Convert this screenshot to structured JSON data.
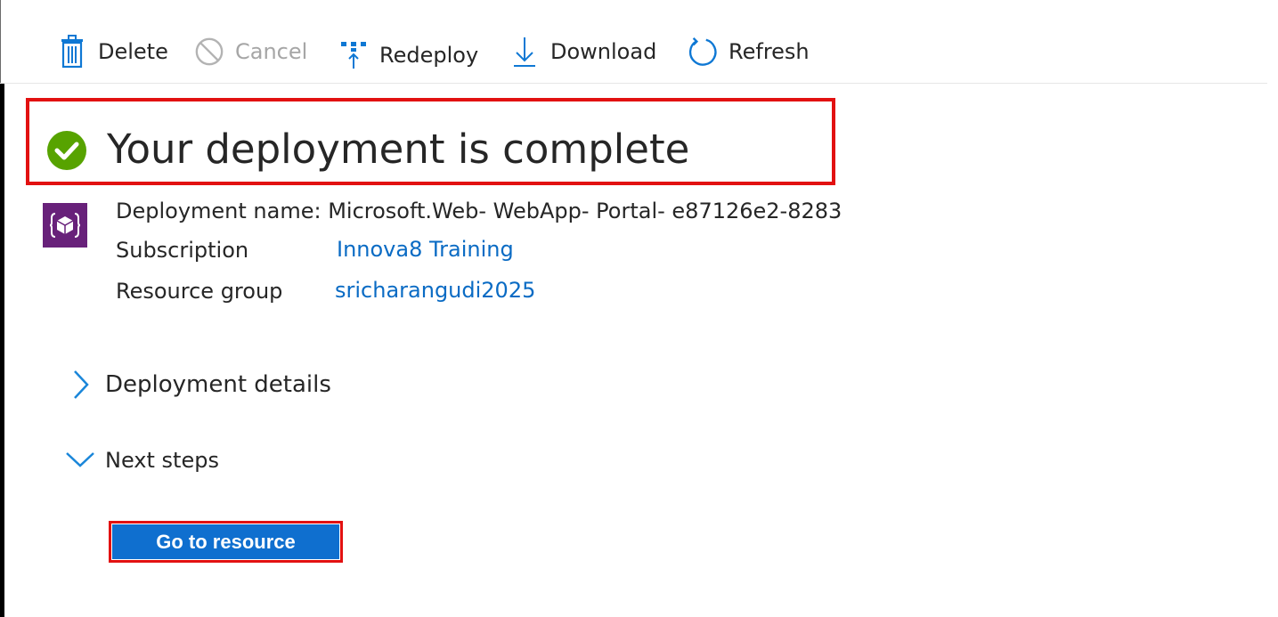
{
  "toolbar": {
    "delete_label": "Delete",
    "cancel_label": "Cancel",
    "redeploy_label": "Redeploy",
    "download_label": "Download",
    "refresh_label": "Refresh"
  },
  "headline": {
    "text": "Your deployment is complete",
    "status": "success"
  },
  "details": {
    "deployment_name": "Deployment name: Microsoft.Web- WebApp- Portal- e87126e2-8283",
    "subscription_label": "Subscription",
    "subscription_value": "Innova8 Training",
    "resource_group_label": "Resource group",
    "resource_group_value": "sricharangudi2025"
  },
  "sections": {
    "deployment_details": "Deployment details",
    "next_steps": "Next steps"
  },
  "actions": {
    "go_to_resource": "Go to resource"
  },
  "colors": {
    "accent": "#0f6fcf",
    "link": "#0a6bc4",
    "success": "#57a300",
    "highlight": "#e21111",
    "resource_icon": "#68217a"
  }
}
